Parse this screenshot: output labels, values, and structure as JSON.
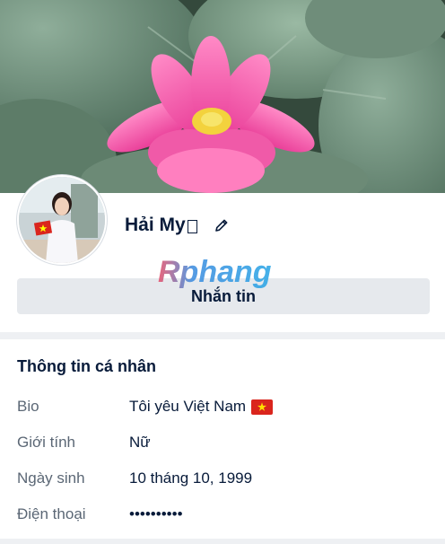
{
  "profile": {
    "name": "Hải My",
    "message_button_label": "Nhắn tin",
    "watermark": "Rphang"
  },
  "icons": {
    "edit": "pencil-icon",
    "name_glyph": "missing-glyph-box",
    "bio_flag": "vietnam-flag-icon"
  },
  "personal_info": {
    "title": "Thông tin cá nhân",
    "rows": [
      {
        "label": "Bio",
        "value": "Tôi yêu Việt Nam"
      },
      {
        "label": "Giới tính",
        "value": "Nữ"
      },
      {
        "label": "Ngày sinh",
        "value": "10 tháng 10, 1999"
      },
      {
        "label": "Điện thoại",
        "value": "••••••••••"
      }
    ]
  },
  "colors": {
    "text_primary": "#081b3a",
    "text_secondary": "#5b6775",
    "button_bg": "#e6e9ed",
    "section_divider": "#eef0f3"
  }
}
